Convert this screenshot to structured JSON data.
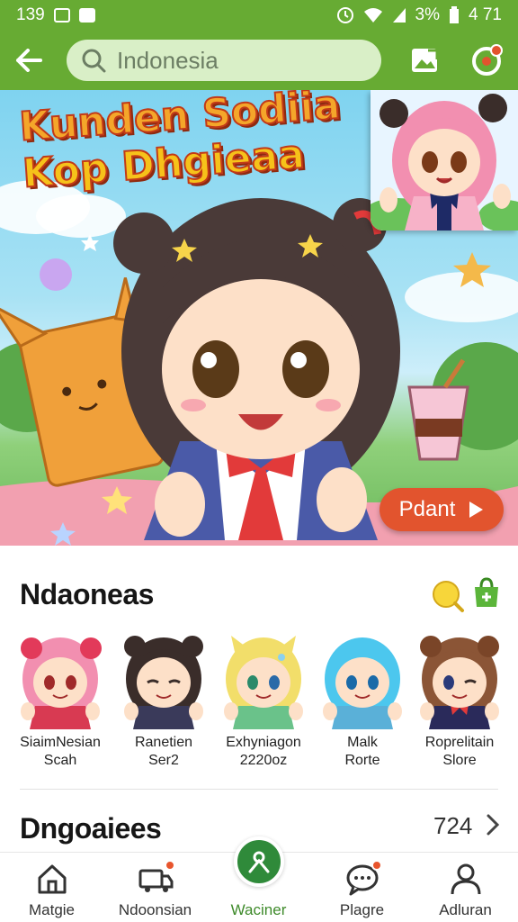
{
  "status_bar": {
    "time": "139",
    "battery": "3%",
    "right_time": "4 71"
  },
  "app_bar": {
    "search_placeholder": "Indonesia"
  },
  "banner": {
    "title_line1": "Kunden Sodiia",
    "title_line2": "Kop Dhgieaa",
    "play_label": "Pdant"
  },
  "section1": {
    "title": "Ndaoneas"
  },
  "characters": [
    {
      "name": "SiaimNesian",
      "sub": "Scah",
      "hair": "#f28fb0"
    },
    {
      "name": "Ranetien",
      "sub": "Ser2",
      "hair": "#3a2d2a"
    },
    {
      "name": "Exhyniagon",
      "sub": "2220oz",
      "hair": "#f2de6a"
    },
    {
      "name": "Malk",
      "sub": "Rorte",
      "hair": "#4cc7ee"
    },
    {
      "name": "Roprelitain",
      "sub": "Slore",
      "hair": "#8b5536"
    }
  ],
  "section2": {
    "title": "Dngoaiees",
    "count": "724"
  },
  "bottom_nav": [
    {
      "label": "Matgie",
      "icon": "home-icon"
    },
    {
      "label": "Ndoonsian",
      "icon": "truck-icon"
    },
    {
      "label": "Waciner",
      "icon": "center-action-icon"
    },
    {
      "label": "Plagre",
      "icon": "chat-icon"
    },
    {
      "label": "Adluran",
      "icon": "profile-icon"
    }
  ],
  "colors": {
    "brand_green": "#67ab33",
    "accent_orange": "#e2542e",
    "fab_green": "#2f8a3a"
  }
}
